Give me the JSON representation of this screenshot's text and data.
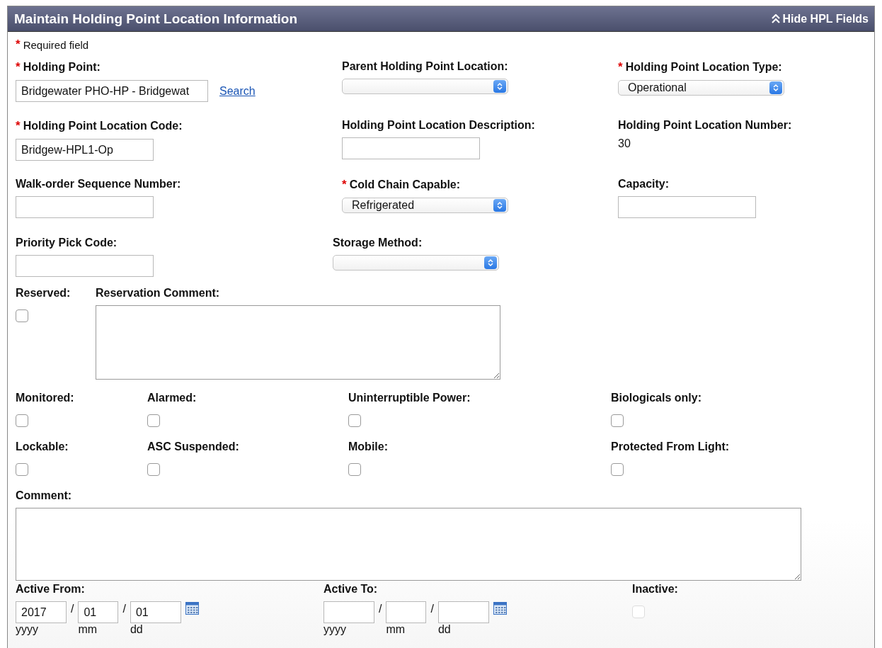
{
  "panel": {
    "title": "Maintain Holding Point Location Information",
    "toggle": "Hide HPL Fields"
  },
  "required_note": {
    "mark": "*",
    "text": "Required field"
  },
  "rows": [
    {
      "fields": [
        {
          "kind": "text",
          "label": "Holding Point:",
          "required": true,
          "value": "Bridgewater PHO-HP - Bridgewat",
          "link": "Search"
        },
        {
          "kind": "select",
          "label": "Parent Holding Point Location:",
          "required": false
        },
        {
          "kind": "select",
          "label": "Holding Point Location Type:",
          "required": true,
          "value": "Operational"
        }
      ]
    },
    {
      "fields": [
        {
          "kind": "text",
          "label": "Holding Point Location Code:",
          "required": true,
          "value": "Bridgew-HPL1-Op"
        },
        {
          "kind": "text",
          "label": "Holding Point Location Description:",
          "required": false
        },
        {
          "kind": "readonly",
          "label": "Holding Point Location Number:",
          "required": false,
          "value": "30"
        }
      ]
    },
    {
      "fields": [
        {
          "kind": "text",
          "label": "Walk-order Sequence Number:",
          "required": false
        },
        {
          "kind": "select",
          "label": "Cold Chain Capable:",
          "required": true,
          "value": "Refrigerated"
        },
        {
          "kind": "text",
          "label": "Capacity:",
          "required": false
        }
      ]
    },
    {
      "fields": [
        {
          "kind": "text",
          "label": "Priority Pick Code:",
          "required": false
        },
        {
          "kind": "select",
          "label": "Storage Method:",
          "required": false
        }
      ]
    },
    {
      "fields": [
        {
          "kind": "checkbox",
          "label": "Reserved:",
          "checked": false,
          "disabled": false
        },
        {
          "kind": "textarea",
          "label": "Reservation Comment:"
        }
      ]
    },
    {
      "fields": [
        {
          "kind": "checkbox",
          "label": "Monitored:",
          "checked": false,
          "disabled": false
        },
        {
          "kind": "checkbox",
          "label": "Alarmed:",
          "checked": false,
          "disabled": false
        },
        {
          "kind": "checkbox",
          "label": "Uninterruptible Power:",
          "checked": false,
          "disabled": false
        },
        {
          "kind": "checkbox",
          "label": "Biologicals only:",
          "checked": false,
          "disabled": false
        }
      ]
    },
    {
      "fields": [
        {
          "kind": "checkbox",
          "label": "Lockable:",
          "checked": false,
          "disabled": false
        },
        {
          "kind": "checkbox",
          "label": "ASC Suspended:",
          "checked": false,
          "disabled": false
        },
        {
          "kind": "checkbox",
          "label": "Mobile:",
          "checked": false,
          "disabled": false
        },
        {
          "kind": "checkbox",
          "label": "Protected From Light:",
          "checked": false,
          "disabled": false
        }
      ]
    },
    {
      "fields": [
        {
          "kind": "textarea",
          "label": "Comment:"
        }
      ]
    },
    {
      "fields": [
        {
          "kind": "date",
          "label": "Active From:",
          "separator": "/",
          "parts": [
            {
              "value": "2017",
              "caption": "yyyy"
            },
            {
              "value": "01",
              "caption": "mm"
            },
            {
              "value": "01",
              "caption": "dd"
            }
          ]
        },
        {
          "kind": "date",
          "label": "Active To:",
          "separator": "/",
          "parts": [
            {
              "caption": "yyyy"
            },
            {
              "caption": "mm"
            },
            {
              "caption": "dd"
            }
          ]
        },
        {
          "kind": "checkbox",
          "label": "Inactive:",
          "checked": false,
          "disabled": true
        }
      ]
    }
  ]
}
